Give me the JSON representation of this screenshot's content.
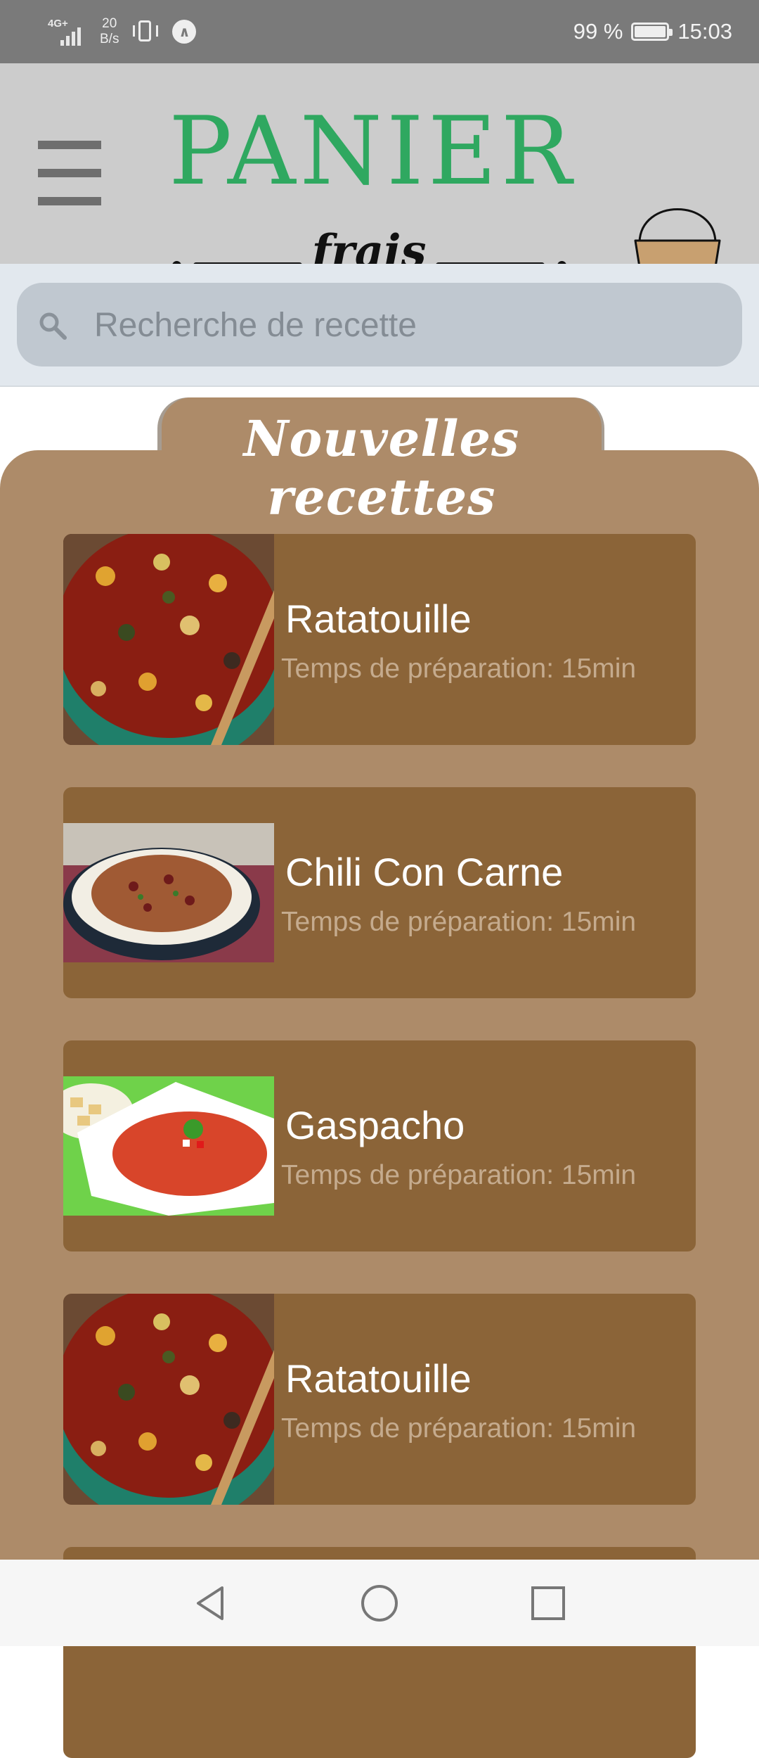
{
  "status_bar": {
    "network": "4G+",
    "speed": "20\nB/s",
    "battery": "99 %",
    "time": "15:03"
  },
  "header": {
    "logo_title": "PANIER",
    "logo_subtitle": "frais"
  },
  "search": {
    "placeholder": "Recherche de recette"
  },
  "section": {
    "title": "Nouvelles recettes"
  },
  "recipes": [
    {
      "name": "Ratatouille",
      "time": "Temps de préparation: 15min"
    },
    {
      "name": "Chili Con Carne",
      "time": "Temps de préparation: 15min"
    },
    {
      "name": "Gaspacho",
      "time": "Temps de préparation: 15min"
    },
    {
      "name": "Ratatouille",
      "time": "Temps de préparation: 15min"
    }
  ],
  "colors": {
    "brand_green": "#2fa860",
    "section_bg": "#ad8b69",
    "card_bg": "#8b6438",
    "search_bg": "#c0c8d0"
  },
  "icons": [
    "menu-icon",
    "basket-icon",
    "search-icon",
    "back-icon",
    "home-icon",
    "recents-icon"
  ]
}
